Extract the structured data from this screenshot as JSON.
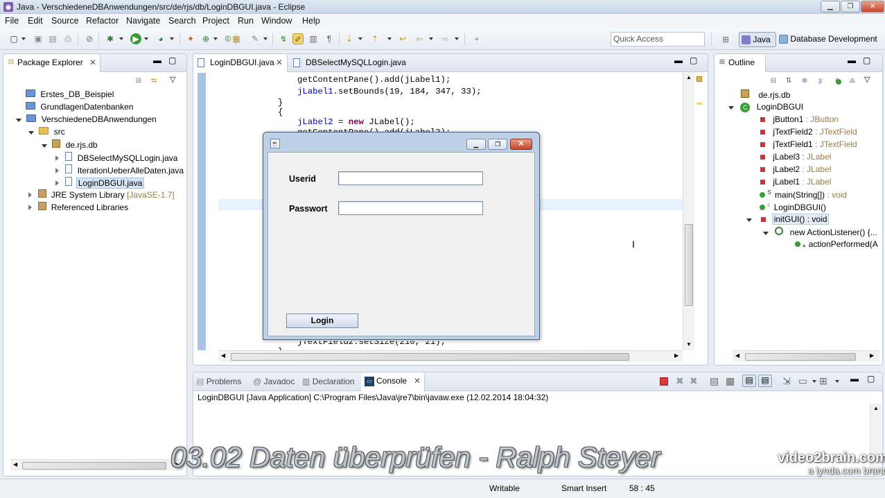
{
  "window": {
    "title": "Java - VerschiedeneDBAnwendungen/src/de/rjs/db/LoginDBGUI.java - Eclipse",
    "app_icon": "eclipse-icon"
  },
  "menu": [
    "File",
    "Edit",
    "Source",
    "Refactor",
    "Navigate",
    "Search",
    "Project",
    "Run",
    "Window",
    "Help"
  ],
  "toolbar": {
    "quick_access_placeholder": "Quick Access",
    "perspectives": [
      "Java",
      "Database Development"
    ]
  },
  "package_explorer": {
    "title": "Package Explorer",
    "items": [
      {
        "label": "Erstes_DB_Beispiel",
        "depth": 0,
        "icon": "project-icon"
      },
      {
        "label": "GrundlagenDatenbanken",
        "depth": 0,
        "icon": "project-icon"
      },
      {
        "label": "VerschiedeneDBAnwendungen",
        "depth": 0,
        "icon": "java-project-icon",
        "expanded": true
      },
      {
        "label": "src",
        "depth": 1,
        "icon": "source-folder-icon",
        "expanded": true
      },
      {
        "label": "de.rjs.db",
        "depth": 2,
        "icon": "package-icon",
        "expanded": true
      },
      {
        "label": "DBSelectMySQLLogin.java",
        "depth": 3,
        "icon": "java-file-icon"
      },
      {
        "label": "IterationUeberAlleDaten.java",
        "depth": 3,
        "icon": "java-file-icon"
      },
      {
        "label": "LoginDBGUI.java",
        "depth": 3,
        "icon": "java-file-icon",
        "selected": true
      },
      {
        "label": "JRE System Library",
        "suffix": "[JavaSE-1.7]",
        "depth": 1,
        "icon": "library-icon"
      },
      {
        "label": "Referenced Libraries",
        "depth": 1,
        "icon": "library-icon"
      }
    ]
  },
  "editor": {
    "tabs": [
      "LoginDBGUI.java",
      "DBSelectMySQLLogin.java"
    ],
    "active_tab": 0,
    "code_lines": [
      "getContentPane().add(jLabel1);",
      "jLabel1.setBounds(19, 184, 347, 33);",
      "}",
      "{",
      "jLabel2 = new JLabel();",
      "getContentPane().add(jLabel2);",
      "jTextField2.setSize(210, 21);",
      "}"
    ]
  },
  "outline": {
    "title": "Outline",
    "items": [
      {
        "label": "de.rjs.db",
        "type": "",
        "icon": "package-icon"
      },
      {
        "label": "LoginDBGUI",
        "type": "",
        "icon": "class-icon"
      },
      {
        "label": "jButton1",
        "type": ": JButton",
        "icon": "private-field-icon"
      },
      {
        "label": "jTextField2",
        "type": ": JTextField",
        "icon": "private-field-icon"
      },
      {
        "label": "jTextField1",
        "type": ": JTextField",
        "icon": "private-field-icon"
      },
      {
        "label": "jLabel3",
        "type": ": JLabel",
        "icon": "private-field-icon"
      },
      {
        "label": "jLabel2",
        "type": ": JLabel",
        "icon": "private-field-icon"
      },
      {
        "label": "jLabel1",
        "type": ": JLabel",
        "icon": "private-field-icon"
      },
      {
        "label": "main(String[])",
        "type": ": void",
        "icon": "public-static-method-icon"
      },
      {
        "label": "LoginDBGUI()",
        "type": "",
        "icon": "constructor-icon"
      },
      {
        "label": "initGUI()",
        "type": ": void",
        "icon": "private-method-icon"
      },
      {
        "label": "new ActionListener() {...",
        "type": "",
        "icon": "anonymous-class-icon"
      },
      {
        "label": "actionPerformed(A",
        "type": "",
        "icon": "public-method-icon"
      }
    ]
  },
  "dialog": {
    "userid_label": "Userid",
    "password_label": "Passwort",
    "userid_value": "",
    "password_value": "",
    "login_label": "Login"
  },
  "bottom_panel": {
    "tabs": [
      "Problems",
      "Javadoc",
      "Declaration",
      "Console"
    ],
    "active_tab": 3,
    "console_header": "LoginDBGUI [Java Application] C:\\Program Files\\Java\\jre7\\bin\\javaw.exe (12.02.2014 18:04:32)"
  },
  "status": {
    "writable": "Writable",
    "insert_mode": "Smart Insert",
    "position": "58 : 45"
  },
  "overlay": {
    "caption": "03.02 Daten überprüfen - Ralph Steyer",
    "brand_line1": "video2brain.com",
    "brand_line2": "a lynda.com brand"
  },
  "colors": {
    "keyword": "#7f0055",
    "field": "#0000c0",
    "selection": "#d6e4f5"
  }
}
